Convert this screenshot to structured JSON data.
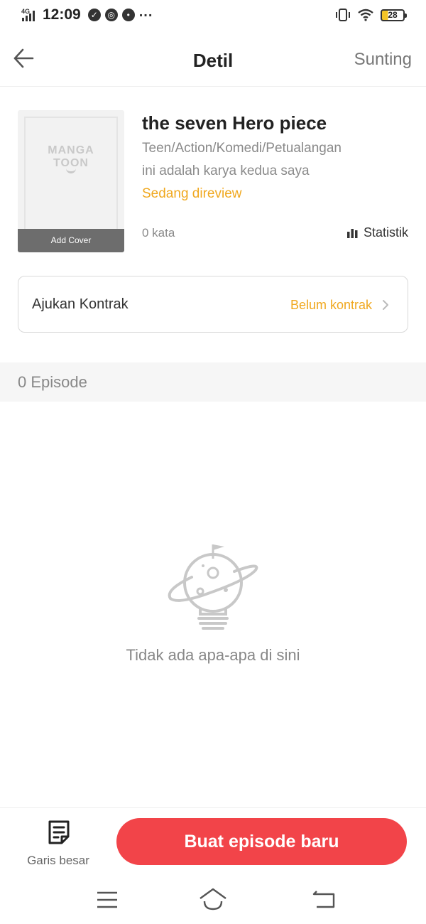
{
  "status_bar": {
    "network": "4G",
    "time": "12:09",
    "battery": "28"
  },
  "header": {
    "title": "Detil",
    "edit_label": "Sunting"
  },
  "cover": {
    "logo_line1": "MANGA",
    "logo_line2": "TOON",
    "add_cover_label": "Add Cover"
  },
  "work": {
    "title": "the seven Hero piece",
    "genres": "Teen/Action/Komedi/Petualangan",
    "description": "ini adalah karya kedua saya",
    "review_status": "Sedang direview",
    "word_count": "0 kata",
    "stats_label": "Statistik"
  },
  "contract": {
    "label": "Ajukan Kontrak",
    "status": "Belum kontrak"
  },
  "episodes": {
    "count_label": "0 Episode",
    "empty_message": "Tidak ada apa-apa di sini"
  },
  "bottom_bar": {
    "outline_label": "Garis besar",
    "new_episode_label": "Buat episode baru"
  },
  "colors": {
    "accent_orange": "#f0a81f",
    "primary_red": "#f24449",
    "muted_gray": "#888888"
  },
  "icons": [
    "back-arrow-icon",
    "bar-chart-icon",
    "chevron-right-icon",
    "planet-lightbulb-icon",
    "outline-document-icon",
    "menu-icon",
    "home-icon",
    "back-icon"
  ]
}
